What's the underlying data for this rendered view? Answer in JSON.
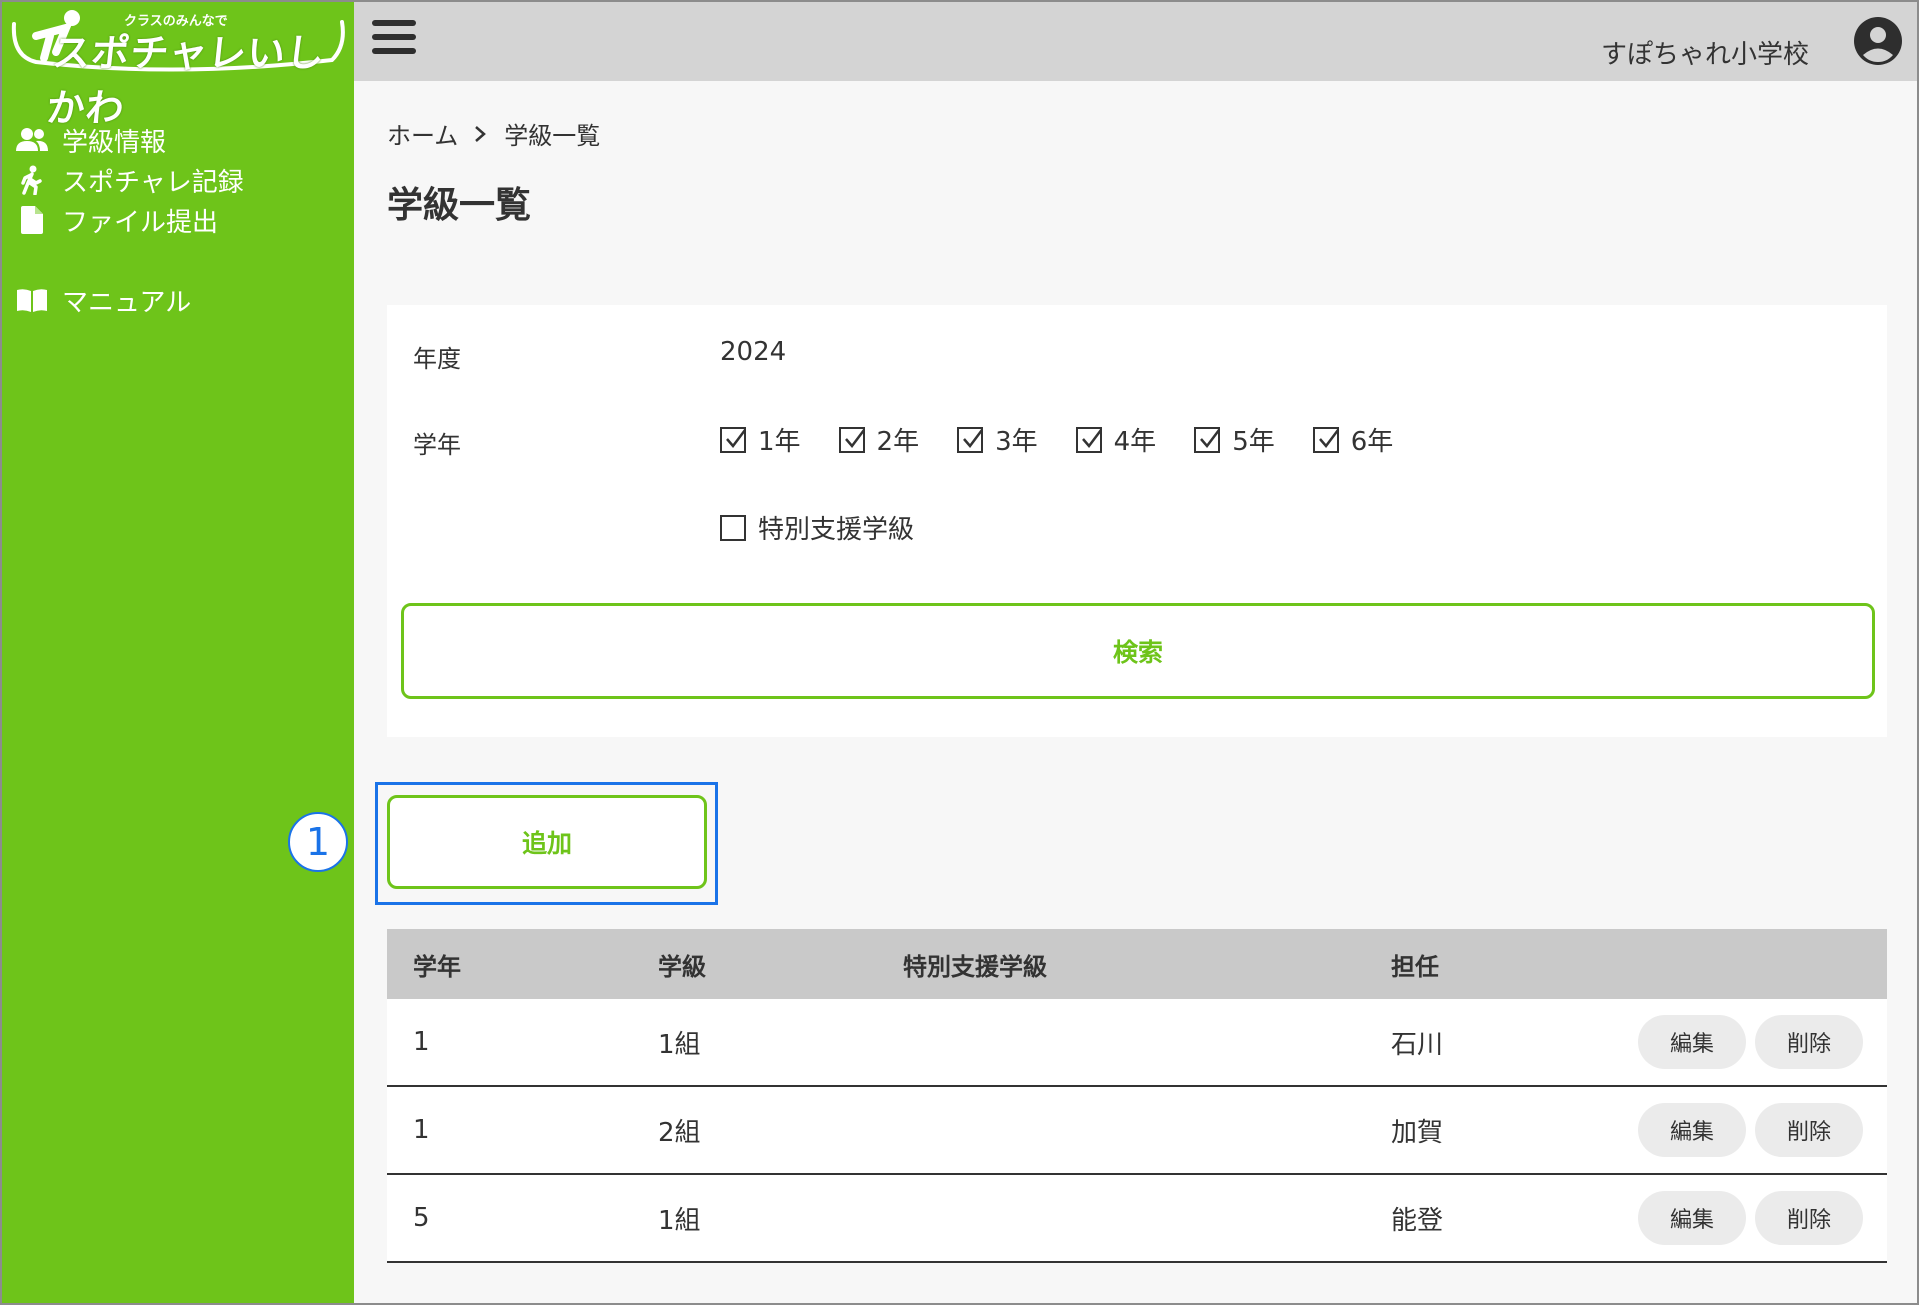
{
  "logo": {
    "tagline": "クラスのみんなで",
    "name": "スポチャレいしかわ"
  },
  "sidebar": {
    "items": [
      {
        "label": "学級情報",
        "icon": "users-icon"
      },
      {
        "label": "スポチャレ記録",
        "icon": "walking-person-icon"
      },
      {
        "label": "ファイル提出",
        "icon": "file-icon"
      }
    ],
    "manual": {
      "label": "マニュアル",
      "icon": "book-icon"
    }
  },
  "header": {
    "school_name": "すぽちゃれ小学校"
  },
  "breadcrumb": {
    "home": "ホーム",
    "current": "学級一覧"
  },
  "page": {
    "title": "学級一覧"
  },
  "search": {
    "year_label": "年度",
    "year_value": "2024",
    "grade_label": "学年",
    "grades": [
      {
        "label": "1年",
        "checked": true
      },
      {
        "label": "2年",
        "checked": true
      },
      {
        "label": "3年",
        "checked": true
      },
      {
        "label": "4年",
        "checked": true
      },
      {
        "label": "5年",
        "checked": true
      },
      {
        "label": "6年",
        "checked": true
      }
    ],
    "special_class": {
      "label": "特別支援学級",
      "checked": false
    },
    "search_button": "検索"
  },
  "add_button": "追加",
  "annotation": {
    "step": "1"
  },
  "table": {
    "headers": [
      "学年",
      "学級",
      "特別支援学級",
      "担任"
    ],
    "rows": [
      {
        "grade": "1",
        "class": "1組",
        "special": "",
        "teacher": "石川",
        "edit": "編集",
        "delete": "削除"
      },
      {
        "grade": "1",
        "class": "2組",
        "special": "",
        "teacher": "加賀",
        "edit": "編集",
        "delete": "削除"
      },
      {
        "grade": "5",
        "class": "1組",
        "special": "",
        "teacher": "能登",
        "edit": "編集",
        "delete": "削除"
      }
    ]
  },
  "colors": {
    "accent": "#6ec41a",
    "highlight": "#1a73e8",
    "header_bg": "#d4d4d4",
    "table_header_bg": "#c9c9c9"
  }
}
